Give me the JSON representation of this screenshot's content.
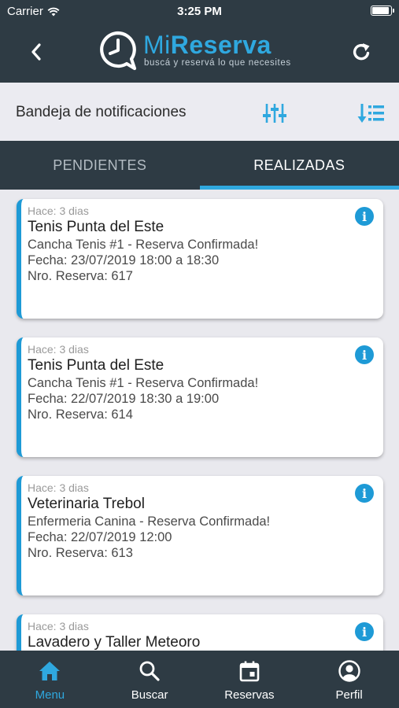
{
  "status_bar": {
    "carrier": "Carrier",
    "time": "3:25 PM",
    "battery_level": 0.9
  },
  "header": {
    "brand_prefix": "Mi",
    "brand_suffix": "Reserva",
    "tagline": "buscá y reservá lo que necesites"
  },
  "toolbar": {
    "title": "Bandeja de notificaciones"
  },
  "tabs": [
    {
      "label": "PENDIENTES",
      "active": false
    },
    {
      "label": "REALIZADAS",
      "active": true
    }
  ],
  "notifications": [
    {
      "ago": "Hace: 3 dias",
      "place": "Tenis Punta del Este",
      "detail": "Cancha Tenis #1 - Reserva Confirmada!",
      "date": "Fecha: 23/07/2019 18:00 a 18:30",
      "number": "Nro. Reserva: 617"
    },
    {
      "ago": "Hace: 3 dias",
      "place": "Tenis Punta del Este",
      "detail": "Cancha Tenis #1 - Reserva Confirmada!",
      "date": "Fecha: 22/07/2019 18:30 a 19:00",
      "number": "Nro. Reserva: 614"
    },
    {
      "ago": "Hace: 3 dias",
      "place": "Veterinaria Trebol",
      "detail": "Enfermeria Canina - Reserva Confirmada!",
      "date": "Fecha: 22/07/2019 12:00",
      "number": "Nro. Reserva: 613"
    },
    {
      "ago": "Hace: 3 dias",
      "place": "Lavadero y Taller Meteoro",
      "detail": "",
      "date": "",
      "number": ""
    }
  ],
  "bottom_nav": [
    {
      "label": "Menu",
      "icon": "home-icon",
      "active": true
    },
    {
      "label": "Buscar",
      "icon": "search-icon",
      "active": false
    },
    {
      "label": "Reservas",
      "icon": "calendar-icon",
      "active": false
    },
    {
      "label": "Perfil",
      "icon": "profile-icon",
      "active": false
    }
  ],
  "colors": {
    "accent": "#2fa8df",
    "header_bg": "#2e3b44",
    "toolbar_bg": "#ebebf1",
    "card_stripe": "#1e9ad6"
  }
}
